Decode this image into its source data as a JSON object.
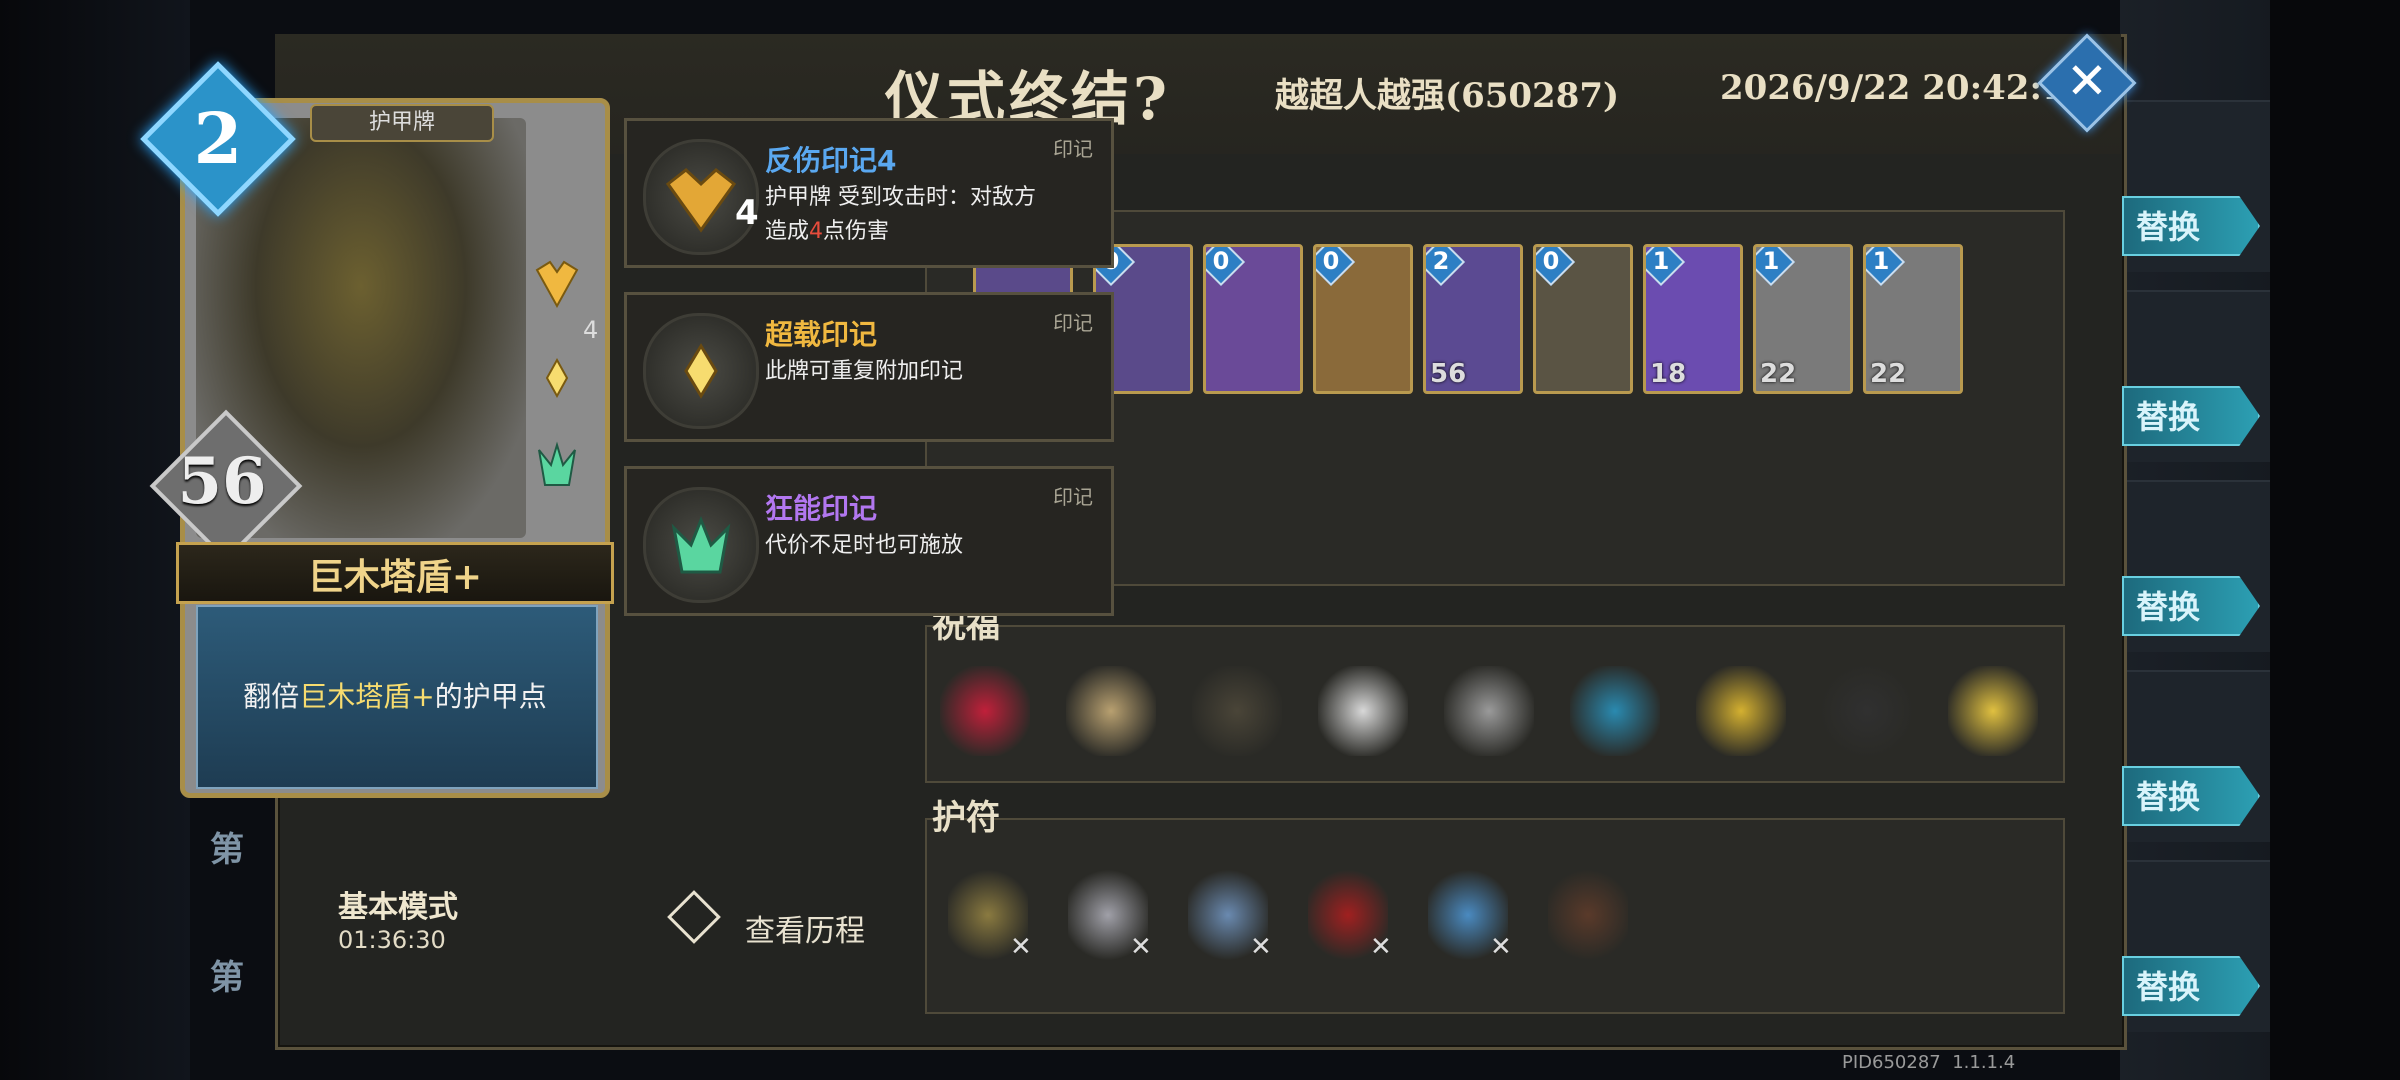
{
  "header": {
    "title": "仪式终结?",
    "player": "越超人越强(650287)",
    "datetime": "2026/9/22 20:42:17",
    "close_icon": "close-icon"
  },
  "card_detail": {
    "type_label": "护甲牌",
    "cost": "2",
    "armor": "56",
    "sigil_count": "4",
    "name": "巨木塔盾+",
    "desc_prefix": "翻倍",
    "desc_highlight": "巨木塔盾+",
    "desc_suffix": "的护甲点"
  },
  "marks": [
    {
      "name": "反伤印记4",
      "tag": "印记",
      "count": "4",
      "line1": "护甲牌 受到攻击时：对敌方",
      "line2_pre": "造成",
      "line2_num": "4",
      "line2_post": "点伤害",
      "color": "#5aa8f0"
    },
    {
      "name": "超载印记",
      "tag": "印记",
      "line1": "此牌可重复附加印记",
      "color": "#f0b840"
    },
    {
      "name": "狂能印记",
      "tag": "印记",
      "line1": "代价不足时也可施放",
      "color": "#b277f0"
    }
  ],
  "deck": {
    "cards": [
      {
        "cost": "0",
        "armor": ""
      },
      {
        "cost": "0",
        "armor": ""
      },
      {
        "cost": "0",
        "armor": ""
      },
      {
        "cost": "2",
        "armor": "56"
      },
      {
        "cost": "0",
        "armor": ""
      },
      {
        "cost": "1",
        "armor": "18"
      },
      {
        "cost": "1",
        "armor": "22"
      },
      {
        "cost": "1",
        "armor": "22"
      }
    ]
  },
  "blessings": {
    "title": "祝福",
    "count": 9
  },
  "amulets": {
    "title": "护符",
    "count": 6
  },
  "footer": {
    "mode": "基本模式",
    "timer": "01:36:30",
    "history": "查看历程",
    "floor_label": "第",
    "pid": "PID650287",
    "version": "1.1.1.4"
  },
  "right_buttons": [
    "替换",
    "替换",
    "替换",
    "替换",
    "替换"
  ],
  "colors": {
    "accent_gold": "#c5a24f",
    "cost_blue": "#2b93c9",
    "replace_teal": "#2c9fb3"
  }
}
